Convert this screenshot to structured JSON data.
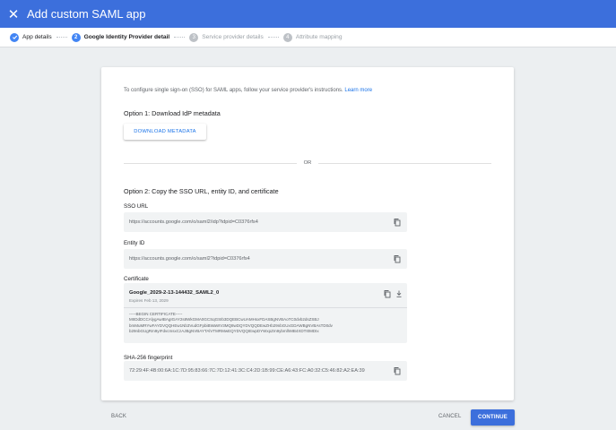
{
  "header": {
    "title": "Add custom SAML app",
    "close_icon": "close-icon"
  },
  "steps": [
    {
      "number": "",
      "label": "App details",
      "state": "done"
    },
    {
      "number": "2",
      "label": "Google Identity Provider detail",
      "state": "active"
    },
    {
      "number": "3",
      "label": "Service provider details",
      "state": "inactive"
    },
    {
      "number": "4",
      "label": "Attribute mapping",
      "state": "inactive"
    }
  ],
  "intro": {
    "text": "To configure single sign-on (SSO) for SAML apps, follow your service provider's instructions.",
    "link": "Learn more"
  },
  "option1": {
    "title": "Option 1: Download IdP metadata",
    "button": "DOWNLOAD METADATA"
  },
  "divider": {
    "text": "OR"
  },
  "option2": {
    "title": "Option 2: Copy the SSO URL, entity ID, and certificate",
    "sso_url_label": "SSO URL",
    "sso_url_value": "https://accounts.google.com/o/saml2/idp?idpid=C0376rfs4",
    "entity_id_label": "Entity ID",
    "entity_id_value": "https://accounts.google.com/o/saml2?idpid=C0376rfs4",
    "certificate_label": "Certificate",
    "certificate_name": "Google_2029-2-13-144432_SAML2_0",
    "certificate_expires": "Expires Feb 13, 2029",
    "certificate_pem": [
      "-----BEGIN CERTIFICATE-----",
      "MIIDdDCCAlygAwIBAgIGAY2s8WkGMA0GCSqGSIb3DQEBCwUAMHsxFDASBgNVBAoTC0dvb2dsZSBJ",
      "bmMuMRYwFAYDVQQHEw1Nb3VudGFpbiBWaWV3MQ8wDQYDVQQDEwZHb29nbGUxGDAWBgNVBAsTD0dv",
      "b29nbGUgRm9yIFdvcmsxCzAJBgNVBAYTAlVTMRMwEQYDVQQIEwpDYWxpZm9ybmlhMB4XDTI0MDIx"
    ],
    "fingerprint_label": "SHA-256 fingerprint",
    "fingerprint_value": "72:29:4F:4B:00:6A:1C:7D:95:83:66:7C:7D:12:41:3C:C4:2D:1B:99:CE:A6:43:FC:A0:32:C5:46:82:A2:EA:39"
  },
  "footer": {
    "back": "BACK",
    "cancel": "CANCEL",
    "continue": "CONTINUE"
  },
  "colors": {
    "accent": "#3c6fdc",
    "link": "#1a73e8",
    "field_bg": "#f1f3f4"
  }
}
